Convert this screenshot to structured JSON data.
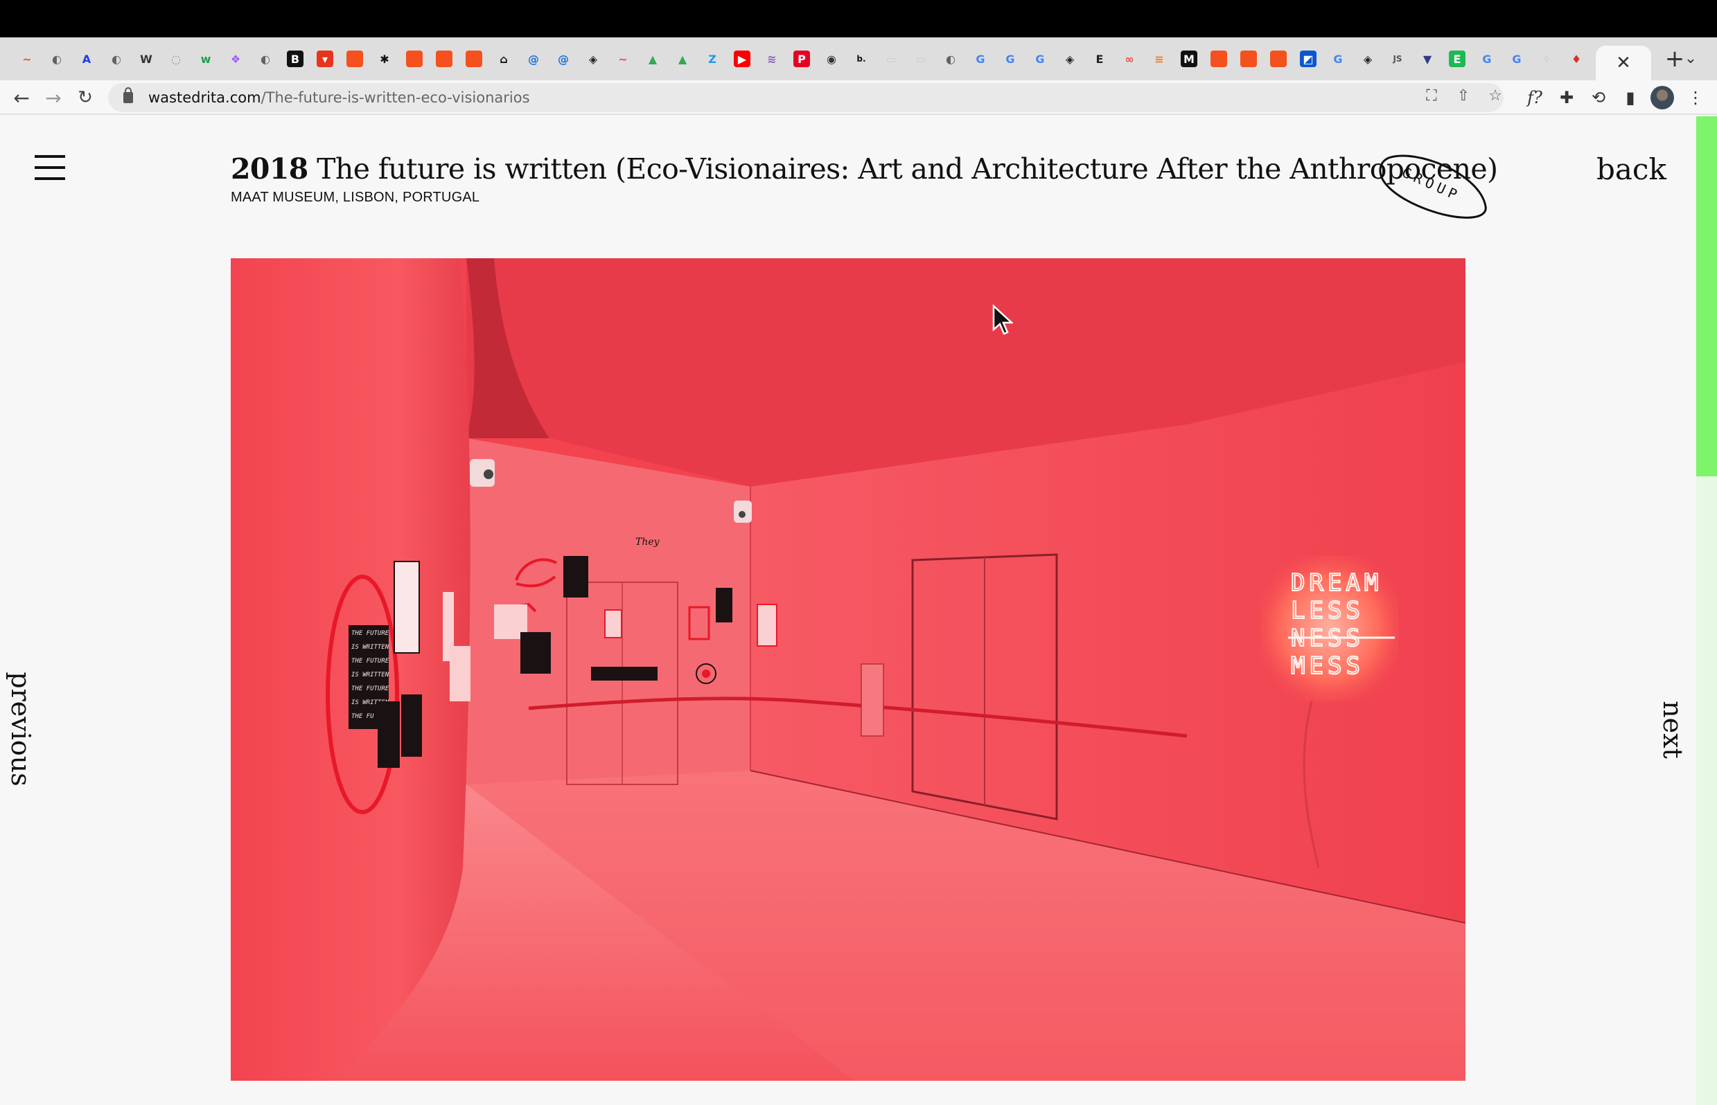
{
  "browser": {
    "tabs": [
      {
        "icon": "swirl-icon",
        "color": "#e9503e",
        "glyph": "~"
      },
      {
        "icon": "globe-icon",
        "color": "#5f6368",
        "glyph": "◐"
      },
      {
        "icon": "letter-a-icon",
        "color": "#1a3ee8",
        "glyph": "A"
      },
      {
        "icon": "globe-icon",
        "color": "#5f6368",
        "glyph": "◐"
      },
      {
        "icon": "letter-w-icon",
        "color": "#333333",
        "glyph": "W"
      },
      {
        "icon": "spinner-icon",
        "color": "#888888",
        "glyph": "◌"
      },
      {
        "icon": "letter-w-icon",
        "color": "#1d9f4f",
        "glyph": "w"
      },
      {
        "icon": "figma-icon",
        "color": "#a259ff",
        "glyph": "❖"
      },
      {
        "icon": "globe-icon",
        "color": "#5f6368",
        "glyph": "◐"
      },
      {
        "icon": "base-icon",
        "color": "#111111",
        "glyph": "B"
      },
      {
        "icon": "gmail-icon",
        "color": "#e8341c",
        "glyph": "▾"
      },
      {
        "icon": "square-icon",
        "color": "#f4511e",
        "glyph": ""
      },
      {
        "icon": "asterisk-icon",
        "color": "#111111",
        "glyph": "✱"
      },
      {
        "icon": "square-icon",
        "color": "#f4511e",
        "glyph": ""
      },
      {
        "icon": "square-icon",
        "color": "#f4511e",
        "glyph": ""
      },
      {
        "icon": "square-icon",
        "color": "#f4511e",
        "glyph": ""
      },
      {
        "icon": "museum-icon",
        "color": "#111111",
        "glyph": "⌂"
      },
      {
        "icon": "at-icon",
        "color": "#1e6fd9",
        "glyph": "@"
      },
      {
        "icon": "at-icon",
        "color": "#1e6fd9",
        "glyph": "@"
      },
      {
        "icon": "codepen-icon",
        "color": "#222222",
        "glyph": "◈"
      },
      {
        "icon": "swirl-icon",
        "color": "#e9503e",
        "glyph": "~"
      },
      {
        "icon": "drive-icon",
        "color": "#34a853",
        "glyph": "▲"
      },
      {
        "icon": "drive-icon",
        "color": "#34a853",
        "glyph": "▲"
      },
      {
        "icon": "letter-z-icon",
        "color": "#1e9be8",
        "glyph": "Z"
      },
      {
        "icon": "youtube-icon",
        "color": "#ff0000",
        "glyph": "▶"
      },
      {
        "icon": "slack-icon",
        "color": "#8b5fbf",
        "glyph": "≋"
      },
      {
        "icon": "pinterest-icon",
        "color": "#e60023",
        "glyph": "P"
      },
      {
        "icon": "globe-icon",
        "color": "#333333",
        "glyph": "◉"
      },
      {
        "icon": "letter-b-icon",
        "color": "#111111",
        "glyph": "b."
      },
      {
        "icon": "blank-icon",
        "color": "#cccccc",
        "glyph": "▭"
      },
      {
        "icon": "blank-icon",
        "color": "#cccccc",
        "glyph": "▭"
      },
      {
        "icon": "globe-icon",
        "color": "#5f6368",
        "glyph": "◐"
      },
      {
        "icon": "google-icon",
        "color": "#4285f4",
        "glyph": "G"
      },
      {
        "icon": "google-icon",
        "color": "#4285f4",
        "glyph": "G"
      },
      {
        "icon": "google-icon",
        "color": "#4285f4",
        "glyph": "G"
      },
      {
        "icon": "codepen-icon",
        "color": "#222222",
        "glyph": "◈"
      },
      {
        "icon": "letter-e-icon",
        "color": "#222222",
        "glyph": "E"
      },
      {
        "icon": "swirl-icon",
        "color": "#e9503e",
        "glyph": "∞"
      },
      {
        "icon": "stack-icon",
        "color": "#f48024",
        "glyph": "≡"
      },
      {
        "icon": "letter-m-icon",
        "color": "#111111",
        "glyph": "M"
      },
      {
        "icon": "square-icon",
        "color": "#f4511e",
        "glyph": ""
      },
      {
        "icon": "square-icon",
        "color": "#f4511e",
        "glyph": ""
      },
      {
        "icon": "square-icon",
        "color": "#f4511e",
        "glyph": ""
      },
      {
        "icon": "diagonal-icon",
        "color": "#0b57d0",
        "glyph": "◩"
      },
      {
        "icon": "google-icon",
        "color": "#4285f4",
        "glyph": "G"
      },
      {
        "icon": "codepen-icon",
        "color": "#222222",
        "glyph": "◈"
      },
      {
        "icon": "js-icon",
        "color": "#555555",
        "glyph": "JS"
      },
      {
        "icon": "diamond-icon",
        "color": "#2d3a8c",
        "glyph": "▼"
      },
      {
        "icon": "letter-e-icon",
        "color": "#1db954",
        "glyph": "E"
      },
      {
        "icon": "google-icon",
        "color": "#4285f4",
        "glyph": "G"
      },
      {
        "icon": "google-icon",
        "color": "#4285f4",
        "glyph": "G"
      },
      {
        "icon": "puzzle-icon",
        "color": "#cccccc",
        "glyph": "✧"
      },
      {
        "icon": "pin-icon",
        "color": "#d93025",
        "glyph": "♦"
      }
    ],
    "active_tab_close": "✕",
    "new_tab": "+",
    "tab_menu": "⌄",
    "url_host": "wastedrita.com",
    "url_path": "/The-future-is-written-eco-visionarios"
  },
  "page": {
    "year": "2018",
    "title": "The future is written (Eco-Visionaires: Art and Architecture After the Anthropocene)",
    "subtitle": "MAAT MUSEUM, LISBON, PORTUGAL",
    "badge": "GROUP",
    "back": "back",
    "previous": "previous",
    "next": "next"
  },
  "artwork": {
    "neon_lines": [
      "DREAM",
      "LESS",
      "NESS",
      "MESS"
    ],
    "poster_lines": [
      "THE FUTURE",
      "IS WRITTEN",
      "THE FUTURE",
      "IS WRITTEN",
      "THE FUTURE",
      "IS WRITTEN",
      "THE FU"
    ]
  },
  "colors": {
    "accent_scrollbar": "#7df56b",
    "room_red": "#f2434f"
  }
}
